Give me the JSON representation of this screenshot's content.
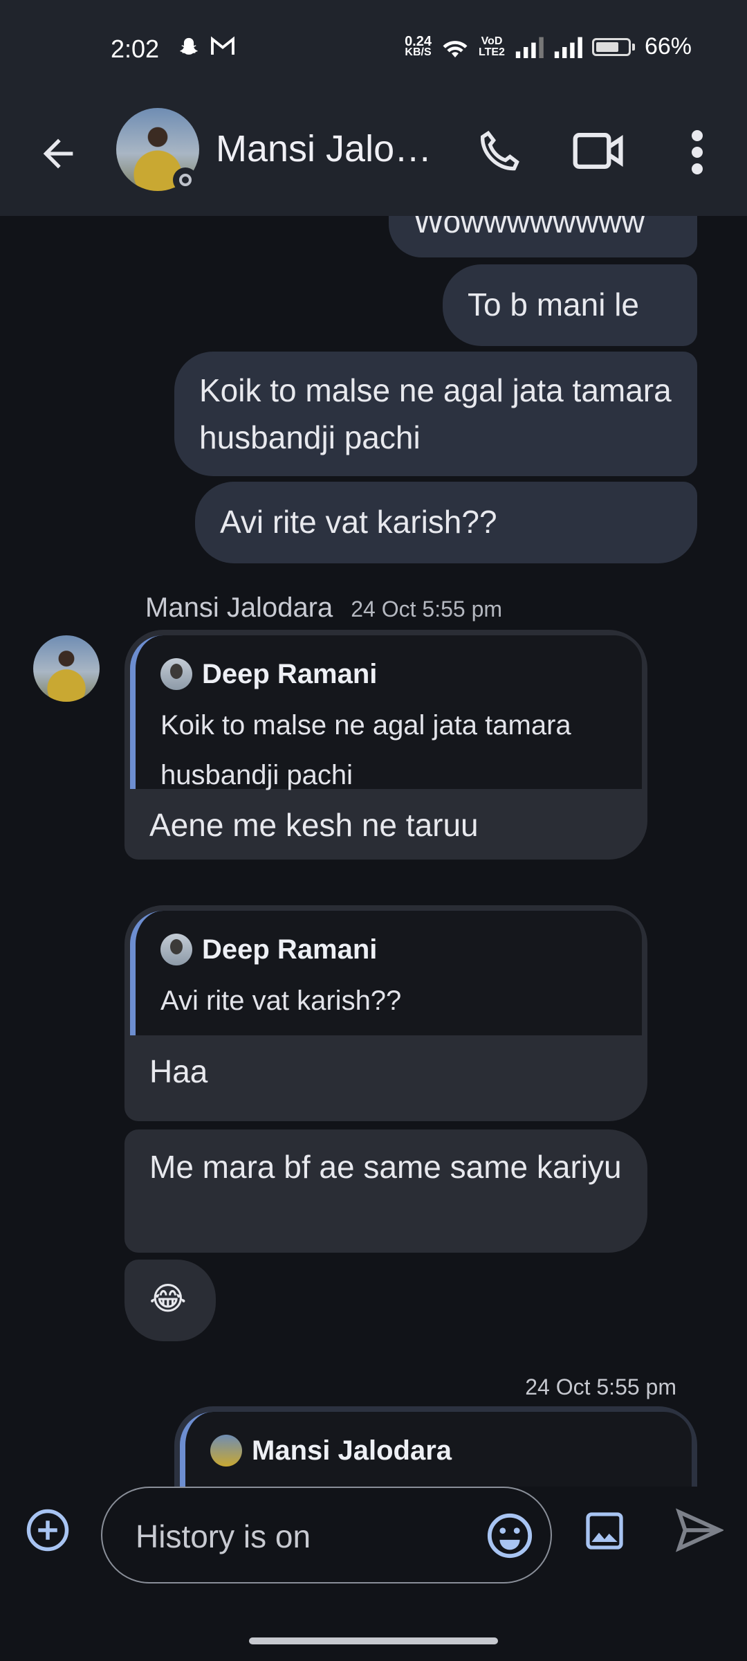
{
  "status_bar": {
    "time": "2:02",
    "net_speed": "0.24",
    "net_unit": "KB/S",
    "volte_label": "VoD",
    "lte_label": "LTE2",
    "battery_percent": "66%",
    "icons": [
      "snapchat-icon",
      "gmail-icon",
      "wifi-icon",
      "signal-icon",
      "battery-icon"
    ]
  },
  "header": {
    "contact_name": "Mansi Jalo…",
    "icons": [
      "back-arrow-icon",
      "phone-icon",
      "video-icon",
      "more-vert-icon"
    ]
  },
  "messages": {
    "out_1": "Wowwwwwwww",
    "out_2": "To b mani le",
    "out_3": "Koik to malse ne agal jata tamara husbandji pachi",
    "out_4": "Avi rite vat karish??",
    "sender_name": "Mansi Jalodara",
    "sender_time": "24 Oct 5:55 pm",
    "in_1": {
      "quote_author": "Deep Ramani",
      "quote_text": "Koik to malse ne agal jata tamara husbandji pachi",
      "text": "Aene me kesh ne taruu"
    },
    "in_2": {
      "quote_author": "Deep Ramani",
      "quote_text": "Avi rite vat karish??",
      "text": "Haa"
    },
    "in_3": "Me mara bf ae same same kariyu",
    "in_4": "😂",
    "out_time": "24 Oct 5:55 pm",
    "out_5_quote_author": "Mansi Jalodara"
  },
  "composer": {
    "placeholder": "History is on",
    "value": "",
    "icons": [
      "add-circle-icon",
      "emoji-icon",
      "image-icon",
      "send-icon"
    ]
  },
  "colors": {
    "background": "#111318",
    "bar": "#20242c",
    "outgoing_bubble": "#2c3240",
    "incoming_bubble": "#2a2d35",
    "quote_accent": "#6d8ed0",
    "composer_icon": "#a8c4f2"
  }
}
